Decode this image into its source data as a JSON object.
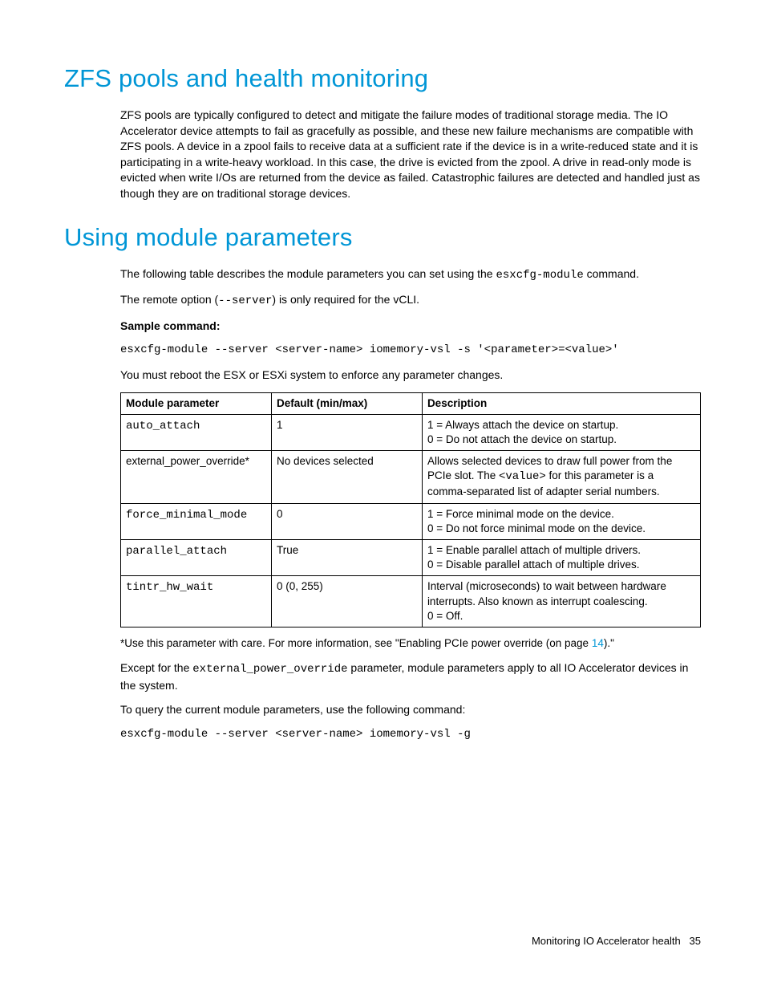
{
  "section1": {
    "heading": "ZFS pools and health monitoring",
    "para": "ZFS pools are typically configured to detect and mitigate the failure modes of traditional storage media. The IO Accelerator device attempts to fail as gracefully as possible, and these new failure mechanisms are compatible with ZFS pools. A device in a zpool fails to receive data at a sufficient rate if the device is in a write-reduced state and it is participating in a write-heavy workload. In this case, the drive is evicted from the zpool. A drive in read-only mode is evicted when write I/Os are returned from the device as failed. Catastrophic failures are detected and handled just as though they are on traditional storage devices."
  },
  "section2": {
    "heading": "Using module parameters",
    "intro_pre": "The following table describes the module parameters you can set using the ",
    "intro_code": "esxcfg-module",
    "intro_post": " command.",
    "remote_pre": "The remote option (",
    "remote_code": "--server",
    "remote_post": ") is only required for the vCLI.",
    "sample_label": "Sample command:",
    "sample_cmd": "esxcfg-module --server <server-name> iomemory-vsl -s '<parameter>=<value>'",
    "reboot_note": "You must reboot the ESX or ESXi system to enforce any parameter changes.",
    "table": {
      "headers": [
        "Module parameter",
        "Default (min/max)",
        "Description"
      ],
      "rows": [
        {
          "param": "auto_attach",
          "param_is_code": true,
          "default": "1",
          "desc": "1 = Always attach the device on startup.\n0 = Do not attach the device on startup."
        },
        {
          "param": "external_power_override*",
          "param_is_code": false,
          "default": "No devices selected",
          "desc_parts": {
            "pre": "Allows selected devices to draw full power from the PCIe slot. The ",
            "code": "<value>",
            "post": " for this parameter is a comma-separated list of adapter serial numbers."
          }
        },
        {
          "param": "force_minimal_mode",
          "param_is_code": true,
          "default": "0",
          "desc": "1 = Force minimal mode on the device.\n0 = Do not force minimal mode on the device."
        },
        {
          "param": "parallel_attach",
          "param_is_code": true,
          "default": "True",
          "desc": "1 = Enable parallel attach of multiple drivers.\n0 = Disable parallel attach of multiple drives."
        },
        {
          "param": "tintr_hw_wait",
          "param_is_code": true,
          "default": "0 (0, 255)",
          "desc": "Interval (microseconds) to wait between hardware interrupts. Also known as interrupt coalescing.\n0 = Off."
        }
      ]
    },
    "footnote_pre": "*Use this parameter with care. For more information, see \"Enabling PCIe power override (on page ",
    "footnote_link": "14",
    "footnote_post": ").\"",
    "except_pre": "Except for the ",
    "except_code": "external_power_override",
    "except_post": " parameter, module parameters apply to all IO Accelerator devices in the system.",
    "query_line": "To query the current module parameters, use the following command:",
    "query_cmd": "esxcfg-module --server <server-name> iomemory-vsl -g"
  },
  "footer": {
    "text": "Monitoring IO Accelerator health",
    "page": "35"
  }
}
